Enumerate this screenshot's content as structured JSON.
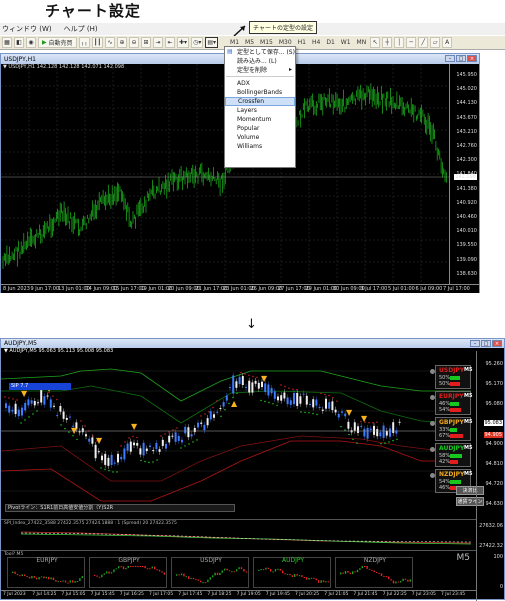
{
  "page_title": "チャート設定",
  "top": {
    "menu": [
      "ウィンドウ (W)",
      "ヘルプ (H)"
    ],
    "tooltip": "チャートの定型の設定",
    "toolbar_buttons": [
      "自動売買"
    ],
    "timeframes": [
      "M1",
      "M5",
      "M15",
      "M30",
      "H1",
      "H4",
      "D1",
      "W1",
      "MN"
    ],
    "chart_label": "USDJPY,H1",
    "chart_info": "▼ USDJPY,H1  142.128 142.128 142.071 142.098",
    "price_labels": [
      "145.950",
      "145.020",
      "144.130",
      "143.670",
      "143.210",
      "142.760",
      "142.300",
      "141.840",
      "141.380",
      "140.920",
      "140.460",
      "140.010",
      "139.550",
      "139.090",
      "138.630"
    ],
    "current_price": "142.098",
    "dates": [
      "8 Jun 2023",
      "9 Jun 17:00",
      "13 Jun 01:00",
      "14 Jun 09:00",
      "15 Jun 17:00",
      "19 Jun 01:00",
      "20 Jun 09:00",
      "21 Jun 17:00",
      "23 Jun 01:00",
      "26 Jun 09:00",
      "27 Jun 17:00",
      "29 Jun 01:00",
      "30 Jun 09:00",
      "3 Jul 17:00",
      "5 Jul 01:00",
      "6 Jul 09:00",
      "7 Jul 17:00"
    ],
    "dropdown": {
      "items": [
        "定型として保存... (S)",
        "読み込み... (L)",
        "定型を削除"
      ],
      "templates": [
        "ADX",
        "BollingerBands",
        "Crossfen",
        "Layers",
        "Momentum",
        "Popular",
        "Volume",
        "Williams"
      ],
      "selected": "Crossfen"
    }
  },
  "down_arrow": "↓",
  "bottom": {
    "chart_label": "AUDJPY,M5",
    "chart_info": "▼ AUDJPY,M5  95.063 95.113 95.008 95.083",
    "blue_tag": "SIP 7.7",
    "price_labels": [
      "95.260",
      "95.170",
      "95.080",
      "94.990",
      "94.900",
      "94.810",
      "94.720",
      "94.630"
    ],
    "current_price": "95.083",
    "red_price": "94.905",
    "panels": [
      {
        "name": "USDJPY",
        "tf": "M5",
        "p1": "50%",
        "p2": "50%",
        "color": "#e21d1d",
        "bar1": 0.5,
        "bar2": 0.5
      },
      {
        "name": "EURJPY",
        "tf": "M5",
        "p1": "46%",
        "p2": "54%",
        "color": "#e21d1d",
        "bar1": 0.46,
        "bar2": 0.54
      },
      {
        "name": "GBPJPY",
        "tf": "M5",
        "p1": "33%",
        "p2": "67%",
        "color": "#f0a81c",
        "bar1": 0.33,
        "bar2": 0.67
      },
      {
        "name": "AUDJPY",
        "tf": "M5",
        "p1": "58%",
        "p2": "42%",
        "color": "#17c81f",
        "bar1": 0.58,
        "bar2": 0.42
      },
      {
        "name": "NZDJPY",
        "tf": "M5",
        "p1": "54%",
        "p2": "46%",
        "color": "#f0a81c",
        "bar1": 0.54,
        "bar2": 0.46
      }
    ],
    "buttons": [
      "決済比",
      "通貨ライン"
    ],
    "info_bar": "Pivotライン：S1R1前日高値安値分割（Y)S2R",
    "sub1_label": "SPI_Index_27422_3588 27422.3575 27424.1888 : 1 (Spread) 20 27422.3575",
    "sub1_values": [
      "27632.06",
      "27422.32"
    ],
    "sub2_label": "Tool? M5",
    "sub2_tf": "M5",
    "sub2_values": [
      "100",
      "0"
    ],
    "mini_charts": [
      "EURJPY",
      "GBPJPY",
      "USDJPY",
      "AUDJPY",
      "NZDJPY"
    ],
    "dates": [
      "7 Jul 2023",
      "7 Jul 14:25",
      "7 Jul 15:05",
      "7 Jul 15:45",
      "7 Jul 16:25",
      "7 Jul 17:05",
      "7 Jul 17:45",
      "7 Jul 18:25",
      "7 Jul 19:05",
      "7 Jul 19:45",
      "7 Jul 20:25",
      "7 Jul 21:05",
      "7 Jul 21:45",
      "7 Jul 22:25",
      "7 Jul 23:05",
      "7 Jul 23:45"
    ]
  }
}
